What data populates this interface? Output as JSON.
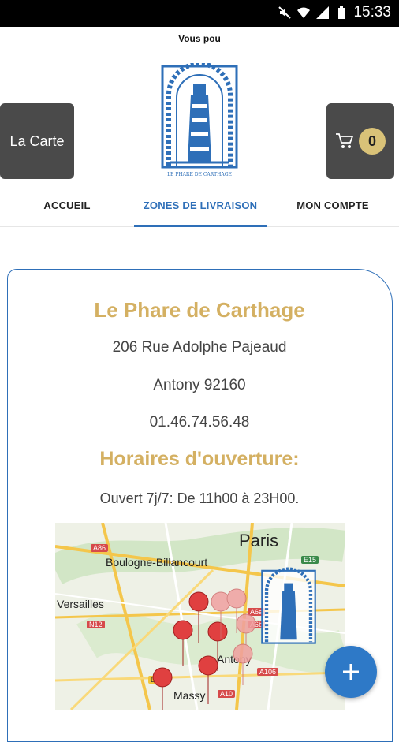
{
  "status": {
    "time": "15:33"
  },
  "ticker": "Vous pou",
  "header": {
    "menu_label": "La Carte",
    "cart_count": "0",
    "logo_text": "LE PHARE DE CARTHAGE"
  },
  "tabs": [
    {
      "label": "ACCUEIL"
    },
    {
      "label": "ZONES DE LIVRAISON"
    },
    {
      "label": "MON COMPTE"
    }
  ],
  "info": {
    "name": "Le Phare de Carthage",
    "address": "206 Rue Adolphe Pajeaud",
    "city": "Antony 92160",
    "phone": "01.46.74.56.48",
    "hours_title": "Horaires d'ouverture:",
    "hours": "Ouvert 7j/7: De 11h00 à 23H00."
  },
  "map": {
    "labels": [
      "Paris",
      "Boulogne-Billancourt",
      "Versailles",
      "Antony",
      "Massy"
    ],
    "roads": [
      "A86",
      "E15",
      "N12",
      "A6a",
      "A6b",
      "A106",
      "D444",
      "A10"
    ]
  },
  "fab": {
    "icon": "plus-icon"
  },
  "colors": {
    "accent": "#2e6fb8",
    "gold": "#d4b062",
    "button": "#4a4a4a"
  }
}
